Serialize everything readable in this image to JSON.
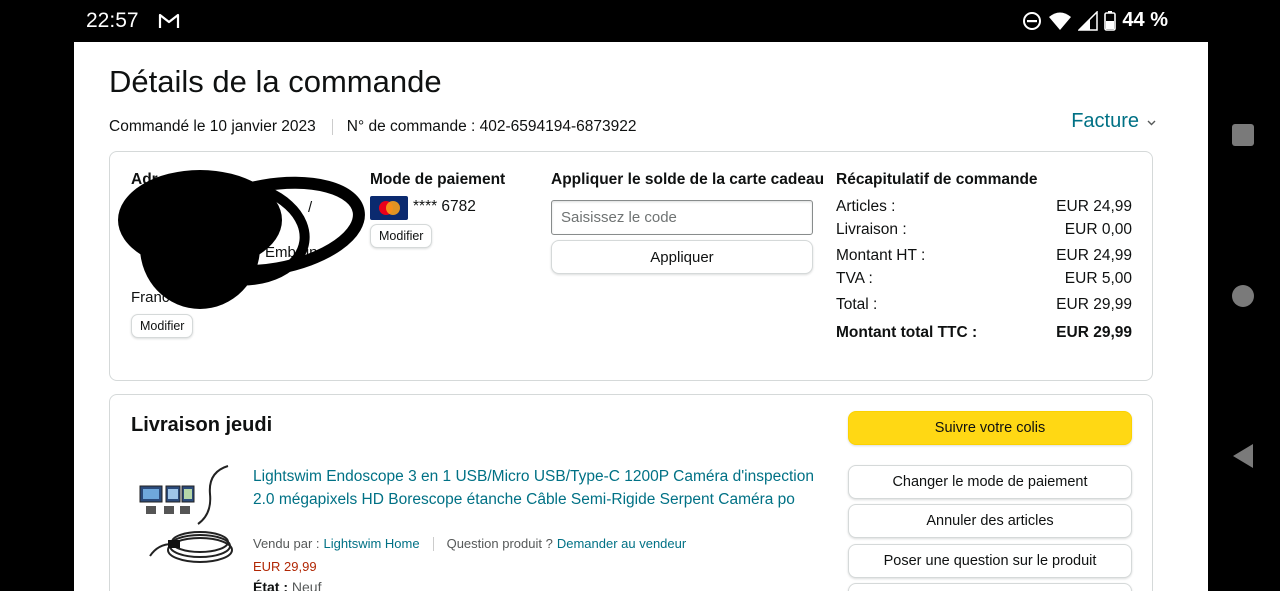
{
  "status_bar": {
    "time": "22:57",
    "battery": "44 %",
    "icons": [
      "gmail-icon",
      "do-not-disturb-icon",
      "wifi-icon",
      "signal-icon",
      "battery-icon"
    ]
  },
  "header": {
    "title": "Détails de la commande",
    "order_date": "Commandé le 10 janvier 2023",
    "order_number": "N° de commande : 402-6594194-6873922",
    "invoice_label": "Facture"
  },
  "address": {
    "heading": "Adr",
    "line_fragment_1": "/",
    "line_fragment_2": "Embrun",
    "country_fragment": "Franc",
    "edit_label": "Modifier"
  },
  "payment": {
    "heading": "Mode de paiement",
    "card_digits": "**** 6782",
    "edit_label": "Modifier"
  },
  "gift_card": {
    "heading": "Appliquer le solde de la carte cadeau",
    "placeholder": "Saisissez le code",
    "apply_label": "Appliquer"
  },
  "summary": {
    "heading": "Récapitulatif de commande",
    "rows": [
      {
        "label": "Articles :",
        "value": "EUR 24,99"
      },
      {
        "label": "Livraison :",
        "value": "EUR 0,00"
      },
      {
        "label": "Montant HT :",
        "value": "EUR 24,99"
      },
      {
        "label": "TVA :",
        "value": "EUR 5,00"
      },
      {
        "label": "Total :",
        "value": "EUR 29,99"
      },
      {
        "label": "Montant total TTC :",
        "value": "EUR 29,99"
      }
    ]
  },
  "delivery": {
    "title": "Livraison jeudi",
    "product_title": "Lightswim Endoscope 3 en 1 USB/Micro USB/Type-C 1200P Caméra d'inspection 2.0 mégapixels HD Borescope étanche Câble Semi-Rigide Serpent Caméra po",
    "sold_by_label": "Vendu par :",
    "seller": "Lightswim Home",
    "question_label": "Question produit ?",
    "ask_seller": "Demander au vendeur",
    "price": "EUR 29,99",
    "state_label": "État :",
    "state_value": "Neuf"
  },
  "actions": {
    "track": "Suivre votre colis",
    "change_payment": "Changer le mode de paiement",
    "cancel_items": "Annuler des articles",
    "ask_question": "Poser une question sur le produit"
  },
  "colors": {
    "link": "#007185",
    "price": "#b12704",
    "primary_button": "#ffd814"
  }
}
